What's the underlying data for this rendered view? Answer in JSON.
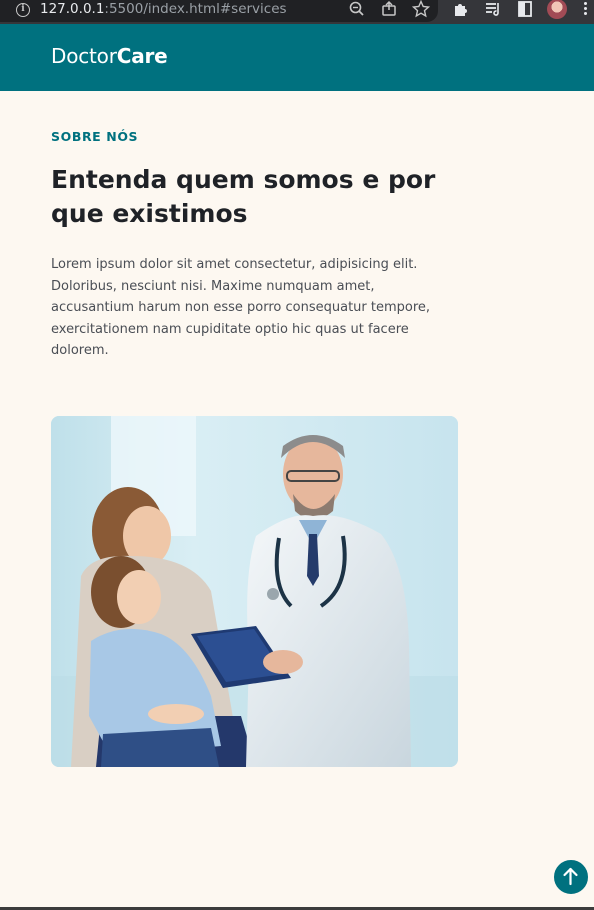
{
  "browser": {
    "url_host": "127.0.0.1",
    "url_path": ":5500/index.html#services",
    "icons": [
      "info-icon",
      "zoom-out-icon",
      "share-icon",
      "bookmark-star-icon",
      "extensions-icon",
      "reading-list-icon",
      "side-panel-icon",
      "profile-avatar",
      "menu-icon"
    ]
  },
  "header": {
    "logo_regular": "Doctor",
    "logo_bold": "Care",
    "background": "#00717f"
  },
  "about": {
    "eyebrow": "SOBRE NÓS",
    "title": "Entenda quem somos e por que existimos",
    "paragraph": "Lorem ipsum dolor sit amet consectetur, adipisicing elit. Doloribus, nesciunt nisi. Maxime numquam amet, accusantium harum non esse porro consequatur tempore, exercitationem nam cupiditate optio hic quas ut facere dolorem.",
    "image_alt": "doctor-with-mother-and-daughter-photo"
  },
  "back_to_top": {
    "icon": "arrow-up-icon",
    "color": "#00717f"
  },
  "colors": {
    "accent": "#00717f",
    "page_background": "#fdf8f1",
    "heading": "#1f2227",
    "body_text": "#4a4e55"
  }
}
